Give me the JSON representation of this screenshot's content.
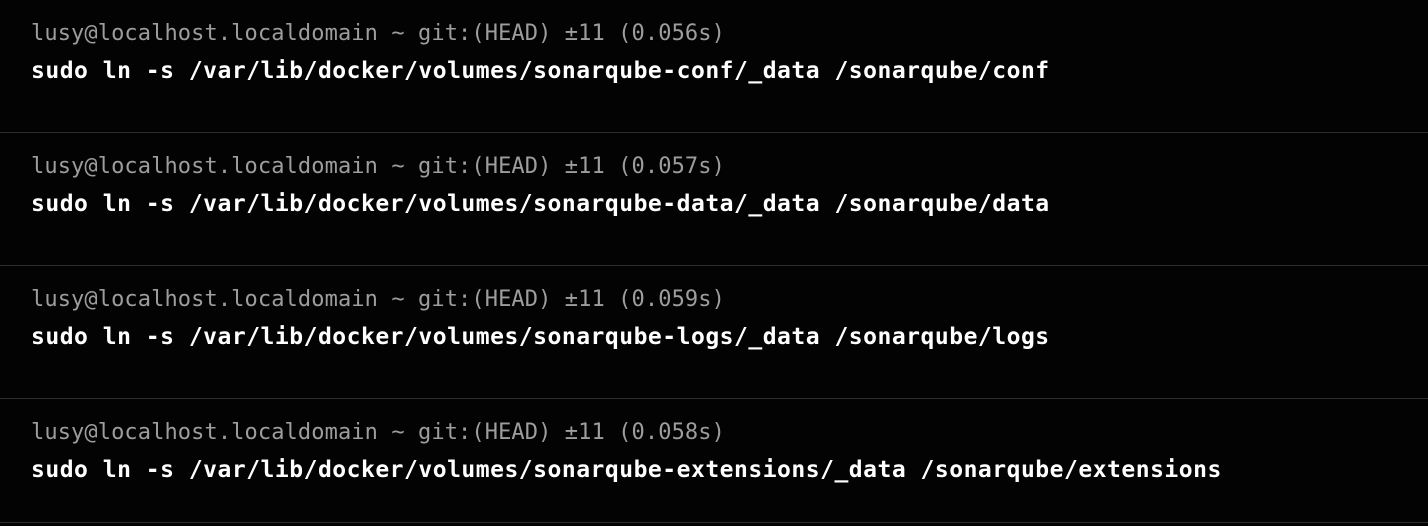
{
  "theme": {
    "background": "#030303",
    "prompt_color": "#9d9d9d",
    "command_color": "#ffffff",
    "divider_color": "#2e2e2e"
  },
  "blocks": [
    {
      "prompt": "lusy@localhost.localdomain ~ git:(HEAD) ±11 (0.056s)",
      "command": "sudo ln -s /var/lib/docker/volumes/sonarqube-conf/_data /sonarqube/conf"
    },
    {
      "prompt": "lusy@localhost.localdomain ~ git:(HEAD) ±11 (0.057s)",
      "command": "sudo ln -s /var/lib/docker/volumes/sonarqube-data/_data /sonarqube/data"
    },
    {
      "prompt": "lusy@localhost.localdomain ~ git:(HEAD) ±11 (0.059s)",
      "command": "sudo ln -s /var/lib/docker/volumes/sonarqube-logs/_data /sonarqube/logs"
    },
    {
      "prompt": "lusy@localhost.localdomain ~ git:(HEAD) ±11 (0.058s)",
      "command": "sudo ln -s /var/lib/docker/volumes/sonarqube-extensions/_data /sonarqube/extensions"
    }
  ]
}
